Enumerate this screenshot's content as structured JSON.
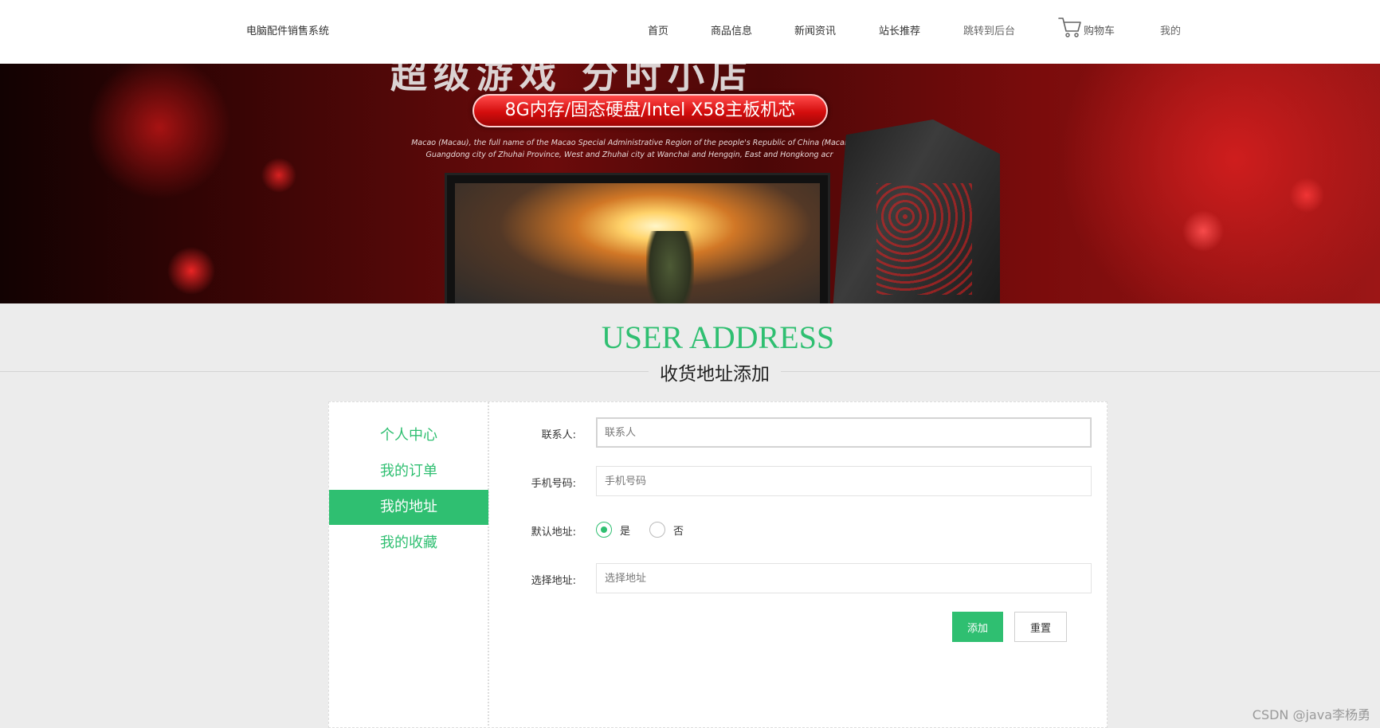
{
  "header": {
    "site_title": "电脑配件销售系统",
    "nav": {
      "home": "首页",
      "products": "商品信息",
      "news": "新闻资讯",
      "recommend": "站长推荐",
      "admin": "跳转到后台",
      "cart": "购物车",
      "mine": "我的"
    },
    "cart_icon": "cart-icon"
  },
  "banner": {
    "headline": "超级游戏 分时小店",
    "pill_text": "8G内存/固态硬盘/Intel X58主板机芯",
    "caption_line1": "Macao (Macau), the full name of the Macao Special Administrative Region of the people's Republic of China (Macar",
    "caption_line2": "Guangdong city of Zhuhai Province, West and Zhuhai city at Wanchai and Hengqin, East and Hongkong acr"
  },
  "section": {
    "title_en": "USER ADDRESS",
    "title_cn": "收货地址添加"
  },
  "sidebar": {
    "items": [
      {
        "label": "个人中心",
        "active": false
      },
      {
        "label": "我的订单",
        "active": false
      },
      {
        "label": "我的地址",
        "active": true
      },
      {
        "label": "我的收藏",
        "active": false
      }
    ]
  },
  "form": {
    "contact": {
      "label": "联系人:",
      "placeholder": "联系人",
      "value": ""
    },
    "phone": {
      "label": "手机号码:",
      "placeholder": "手机号码",
      "value": ""
    },
    "default_address": {
      "label": "默认地址:",
      "options": [
        {
          "label": "是",
          "checked": true
        },
        {
          "label": "否",
          "checked": false
        }
      ]
    },
    "address": {
      "label": "选择地址:",
      "placeholder": "选择地址",
      "value": ""
    },
    "submit_label": "添加",
    "reset_label": "重置"
  },
  "colors": {
    "accent": "#2fbf71",
    "background": "#ececec"
  },
  "watermark": "CSDN @java李杨勇"
}
